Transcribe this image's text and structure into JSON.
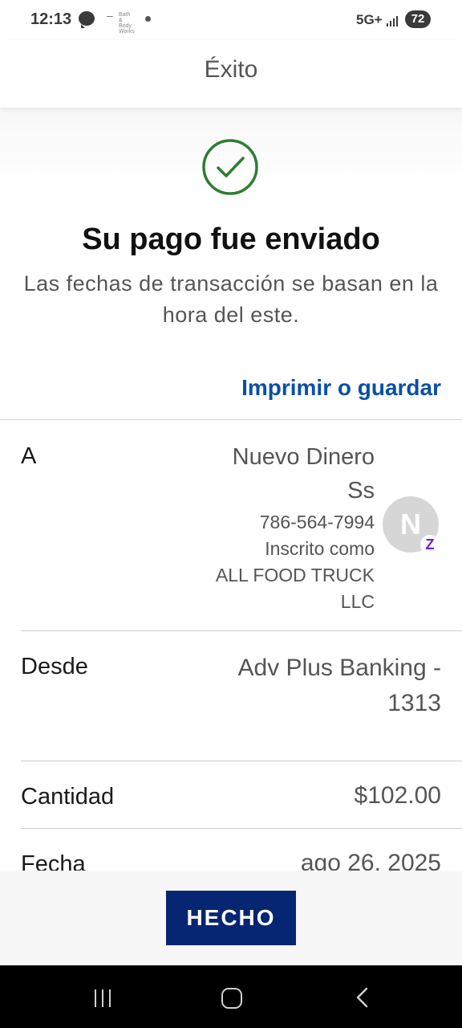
{
  "status_bar": {
    "time": "12:13",
    "app_label": "Bath & Body Works",
    "network": "5G+",
    "battery": "72"
  },
  "header": {
    "title": "Éxito"
  },
  "success": {
    "title": "Su pago fue enviado",
    "subtitle": "Las fechas de transacción se basan en la hora del este.",
    "print_link": "Imprimir o guardar"
  },
  "details": {
    "to": {
      "label": "A",
      "name_line1": "Nuevo Dinero",
      "name_line2": "Ss",
      "phone": "786-564-7994",
      "enrolled_label": "Inscrito como",
      "enrolled_line1": "ALL FOOD TRUCK",
      "enrolled_line2": "LLC",
      "avatar_initial": "N",
      "zelle_badge": "Z"
    },
    "from": {
      "label": "Desde",
      "account_line1": "Adv Plus Banking -",
      "account_line2": "1313"
    },
    "amount": {
      "label": "Cantidad",
      "value": "$102.00"
    },
    "date": {
      "label": "Fecha",
      "value": "ago 26, 2025"
    }
  },
  "footer": {
    "done_button": "HECHO"
  },
  "colors": {
    "brand_blue": "#062572",
    "link_blue": "#0b4fa3",
    "success_green": "#2e7d32",
    "zelle_purple": "#6d1ed4"
  }
}
